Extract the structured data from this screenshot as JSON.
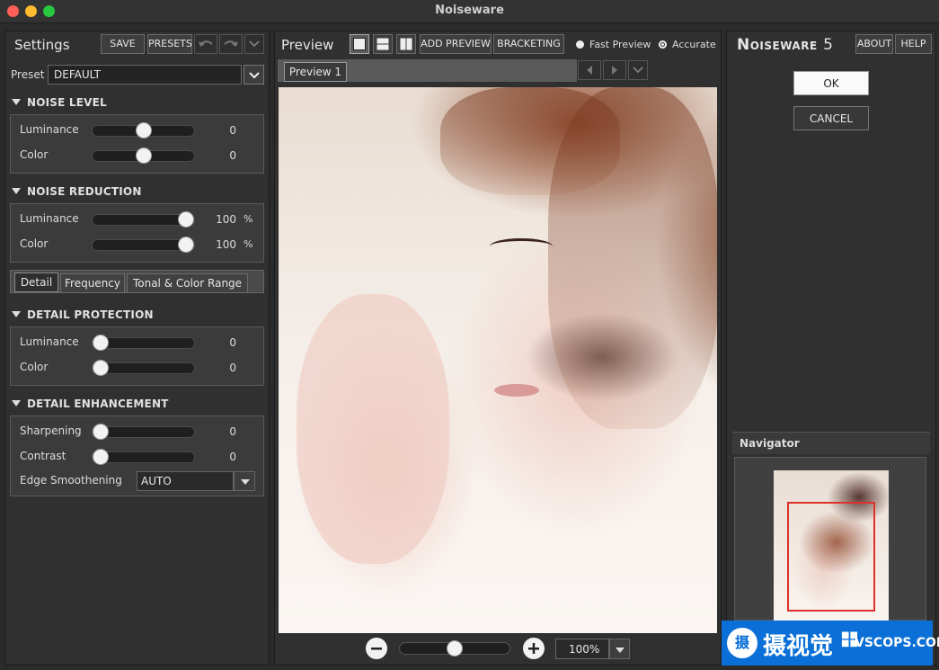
{
  "window": {
    "title": "Noiseware"
  },
  "settings": {
    "title": "Settings",
    "save": "SAVE",
    "presets": "PRESETS",
    "preset_label": "Preset",
    "preset_value": "DEFAULT",
    "noise_level": {
      "title": "NOISE LEVEL",
      "luminance": {
        "label": "Luminance",
        "value": "0",
        "position": 0.5
      },
      "color": {
        "label": "Color",
        "value": "0",
        "position": 0.5
      }
    },
    "noise_reduction": {
      "title": "NOISE REDUCTION",
      "luminance": {
        "label": "Luminance",
        "value": "100",
        "unit": "%",
        "position": 1.0
      },
      "color": {
        "label": "Color",
        "value": "100",
        "unit": "%",
        "position": 1.0
      }
    },
    "tabs": [
      "Detail",
      "Frequency",
      "Tonal & Color Range"
    ],
    "detail_protection": {
      "title": "DETAIL PROTECTION",
      "luminance": {
        "label": "Luminance",
        "value": "0",
        "position": 0.0
      },
      "color": {
        "label": "Color",
        "value": "0",
        "position": 0.0
      }
    },
    "detail_enhancement": {
      "title": "DETAIL ENHANCEMENT",
      "sharpening": {
        "label": "Sharpening",
        "value": "0",
        "position": 0.0
      },
      "contrast": {
        "label": "Contrast",
        "value": "0",
        "position": 0.0
      },
      "edge_smoothing": {
        "label": "Edge Smoothening",
        "value": "AUTO"
      }
    }
  },
  "preview": {
    "title": "Preview",
    "add_preview": "ADD PREVIEW",
    "bracketing": "BRACKETING",
    "fast_preview": "Fast Preview",
    "accurate": "Accurate",
    "tab": "Preview 1",
    "zoom": "100%",
    "zoom_slider": 0.5
  },
  "right": {
    "logo_main": "Noiseware",
    "logo_num": "5",
    "about": "ABOUT",
    "help": "HELP",
    "ok": "OK",
    "cancel": "CANCEL",
    "navigator": "Navigator"
  },
  "watermark": {
    "cn": "摄视觉",
    "en": "VSCOPS.COM",
    "badge": "摄"
  },
  "colors": {
    "accent_red": "#e0302a",
    "watermark_blue": "#0a6fd6"
  }
}
